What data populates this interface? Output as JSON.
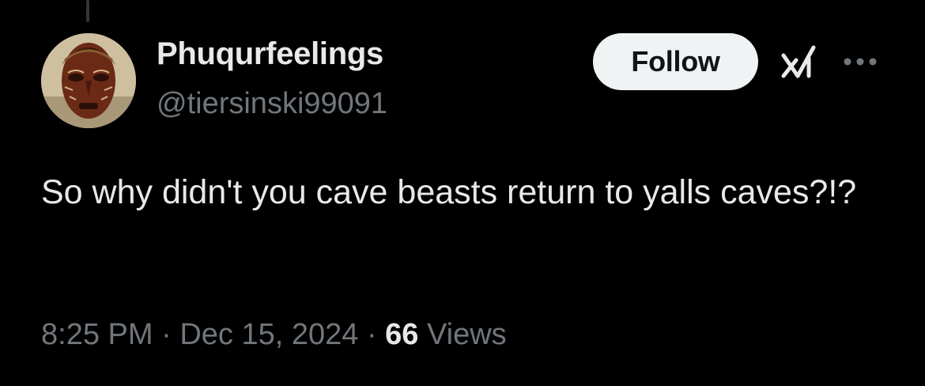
{
  "tweet": {
    "author": {
      "display_name": "Phuqurfeelings",
      "handle": "@tiersinski99091",
      "avatar_icon": "carved-mask-avatar"
    },
    "follow_label": "Follow",
    "text": "So why didn't you cave beasts return to yalls caves?!?",
    "time": "8:25 PM",
    "separator": "·",
    "date": "Dec 15, 2024",
    "views_count": "66",
    "views_label": "Views"
  },
  "icons": {
    "grok": "grok-icon",
    "more": "more-options-icon"
  },
  "colors": {
    "background": "#000000",
    "primary_text": "#e7e9ea",
    "secondary_text": "#71767b",
    "follow_bg": "#eff3f4",
    "follow_text": "#0f1419"
  }
}
